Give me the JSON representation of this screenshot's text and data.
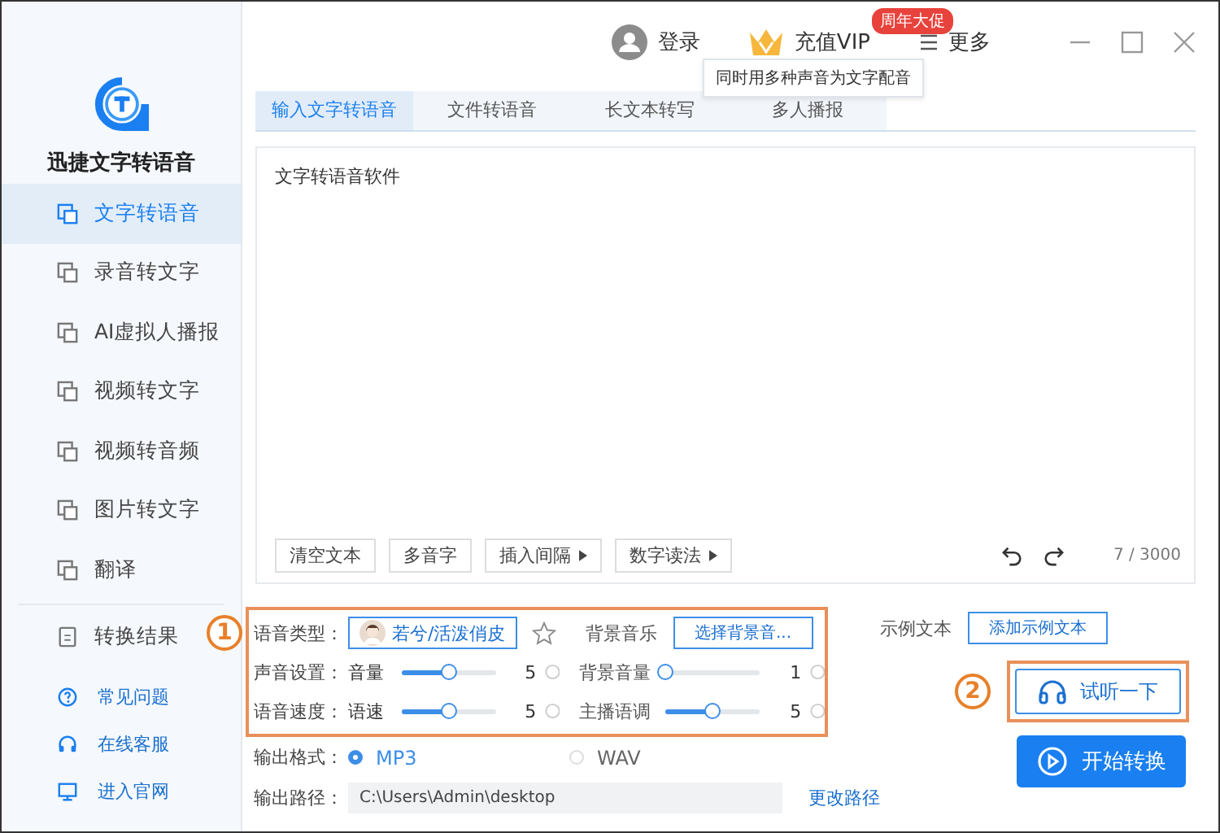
{
  "app": {
    "title": "迅捷文字转语音"
  },
  "sidebar": {
    "items": [
      {
        "label": "文字转语音",
        "selected": true
      },
      {
        "label": "录音转文字",
        "selected": false
      },
      {
        "label": "AI虚拟人播报",
        "selected": false
      },
      {
        "label": "视频转文字",
        "selected": false
      },
      {
        "label": "视频转音频",
        "selected": false
      },
      {
        "label": "图片转文字",
        "selected": false
      },
      {
        "label": "翻译",
        "selected": false
      }
    ],
    "result_item": "转换结果",
    "links": [
      {
        "label": "常见问题",
        "kind": "help"
      },
      {
        "label": "在线客服",
        "kind": "support"
      },
      {
        "label": "进入官网",
        "kind": "website"
      }
    ]
  },
  "header": {
    "login": "登录",
    "vip": "充值VIP",
    "vip_badge": "周年大促",
    "more": "更多",
    "tooltip": "同时用多种声音为文字配音"
  },
  "tabs": [
    {
      "label": "输入文字转语音",
      "selected": true
    },
    {
      "label": "文件转语音",
      "selected": false
    },
    {
      "label": "长文本转写",
      "selected": false
    },
    {
      "label": "多人播报",
      "selected": false
    }
  ],
  "editor": {
    "text": "文字转语音软件",
    "counter": "7 / 3000",
    "tools": [
      {
        "label": "清空文本",
        "menu": false
      },
      {
        "label": "多音字",
        "menu": false
      },
      {
        "label": "插入间隔",
        "menu": true
      },
      {
        "label": "数字读法",
        "menu": true
      }
    ]
  },
  "settings": {
    "voice_label": "语音类型：",
    "voice": "若兮/活泼俏皮",
    "favorite": false,
    "music_label": "背景音乐",
    "music_button": "选择背景音...",
    "rows": [
      {
        "label": "声音设置：",
        "sliders": [
          {
            "label": "音量",
            "level": 0.5,
            "reading": "5"
          },
          {
            "label": "背景音量",
            "level": 0,
            "reading": "1"
          }
        ]
      },
      {
        "label": "语音速度：",
        "sliders": [
          {
            "label": "语速",
            "level": 0.5,
            "reading": "5"
          },
          {
            "label": "主播语调",
            "level": 0.5,
            "reading": "5"
          }
        ]
      }
    ]
  },
  "sample": {
    "label": "示例文本",
    "button": "添加示例文本"
  },
  "output": {
    "format_label": "输出格式：",
    "formats": [
      {
        "label": "MP3",
        "selected": true
      },
      {
        "label": "WAV",
        "selected": false
      }
    ],
    "path_label": "输出路径：",
    "path": "C:\\Users\\Admin\\desktop",
    "change": "更改路径"
  },
  "actions": {
    "preview": "试听一下",
    "start": "开始转换"
  },
  "annotations": [
    "1",
    "2"
  ]
}
